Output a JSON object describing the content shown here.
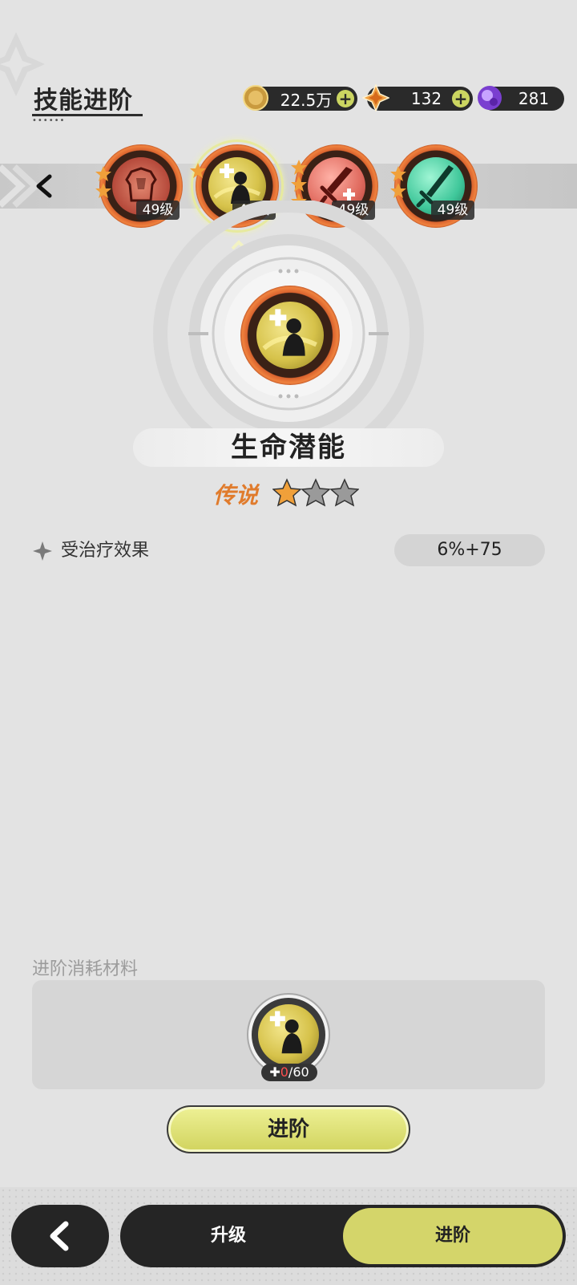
{
  "header": {
    "title": "技能进阶"
  },
  "currencies": [
    {
      "icon": "gold-coin-icon",
      "value": "22.5万",
      "has_plus": true
    },
    {
      "icon": "orange-crystal-icon",
      "value": "132",
      "has_plus": true
    },
    {
      "icon": "purple-gem-icon",
      "value": "281",
      "has_plus": false
    }
  ],
  "skills": [
    {
      "name": "armor-skill",
      "level": "49级",
      "color": "#c0503e",
      "stars": 2,
      "selected": false
    },
    {
      "name": "life-potential-skill",
      "level": "49级",
      "color": "#d8c64c",
      "stars": 1,
      "selected": true
    },
    {
      "name": "sword-skill",
      "level": "49级",
      "color": "#e0625a",
      "stars": 3,
      "selected": false
    },
    {
      "name": "green-blade-skill",
      "level": "49级",
      "color": "#3fc79a",
      "stars": 2,
      "selected": false
    }
  ],
  "selected_skill": {
    "name": "生命潜能",
    "rarity": "传说",
    "stars_filled": 1,
    "stars_total": 3,
    "attribute_label": "受治疗效果",
    "attribute_value": "6%+75"
  },
  "materials": {
    "title": "进阶消耗材料",
    "have": "0",
    "need": "/60"
  },
  "advance_button": "进阶",
  "bottom_nav": {
    "upgrade_tab": "升级",
    "advance_tab": "进阶"
  },
  "colors": {
    "accent": "#d4d56a",
    "rarity": "#e07b2c",
    "ring": "#e06a30"
  }
}
